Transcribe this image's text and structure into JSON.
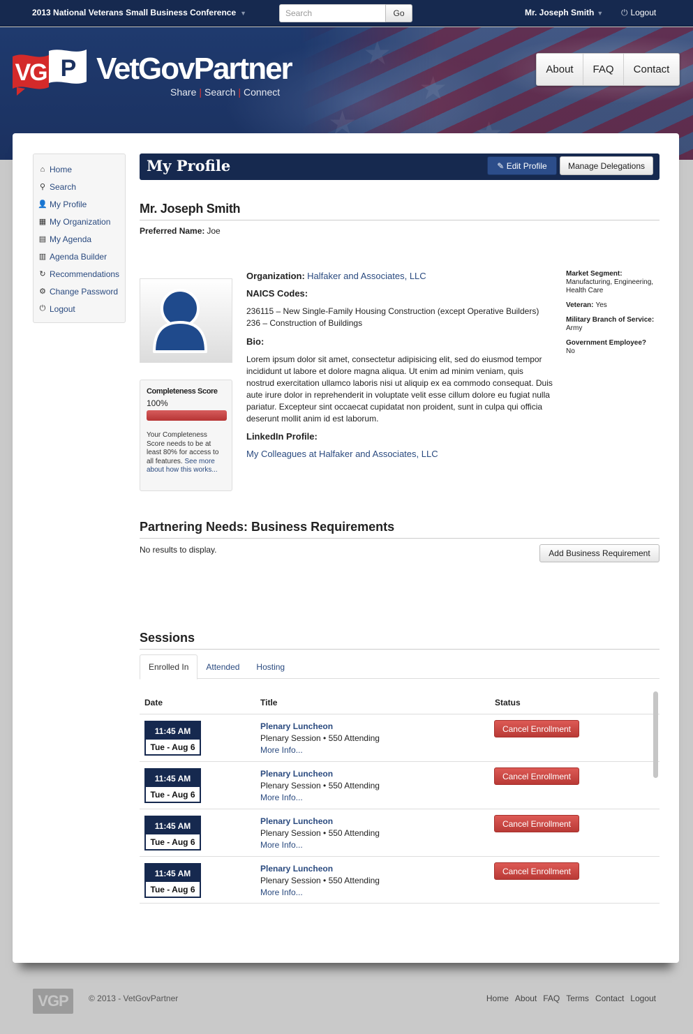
{
  "topbar": {
    "conference": "2013 National Veterans Small Business Conference",
    "search_placeholder": "Search",
    "go_label": "Go",
    "user": "Mr. Joseph Smith",
    "logout": "Logout"
  },
  "brand": {
    "logo_mark": "VGP",
    "name": "VetGovPartner",
    "tagline": [
      "Share",
      "Search",
      "Connect"
    ]
  },
  "nav": [
    "About",
    "FAQ",
    "Contact"
  ],
  "sidebar": [
    {
      "label": "Home",
      "icon": "home-icon",
      "glyph": "⌂"
    },
    {
      "label": "Search",
      "icon": "search-icon",
      "glyph": "⚲"
    },
    {
      "label": "My Profile",
      "icon": "user-icon",
      "glyph": "👤"
    },
    {
      "label": "My Organization",
      "icon": "grid-icon",
      "glyph": "▦"
    },
    {
      "label": "My Agenda",
      "icon": "list-icon",
      "glyph": "▤"
    },
    {
      "label": "Agenda Builder",
      "icon": "calendar-icon",
      "glyph": "▥"
    },
    {
      "label": "Recommendations",
      "icon": "refresh-icon",
      "glyph": "↻"
    },
    {
      "label": "Change Password",
      "icon": "cog-icon",
      "glyph": "⚙"
    },
    {
      "label": "Logout",
      "icon": "power-icon",
      "glyph": "⏻"
    }
  ],
  "header": {
    "title": "My Profile",
    "edit_label": "Edit Profile",
    "delegations_label": "Manage Delegations"
  },
  "profile": {
    "name": "Mr. Joseph Smith",
    "preferred_label": "Preferred Name:",
    "preferred_value": "Joe",
    "org_label": "Organization:",
    "org_value": "Halfaker and Associates, LLC",
    "naics_label": "NAICS Codes:",
    "naics": [
      "236115 – New Single-Family Housing Construction (except Operative Builders)",
      "236 – Construction of Buildings"
    ],
    "bio_label": "Bio:",
    "bio": "Lorem ipsum dolor sit amet, consectetur adipisicing elit, sed do eiusmod tempor incididunt ut labore et dolore magna aliqua. Ut enim ad minim veniam, quis nostrud exercitation ullamco laboris nisi ut aliquip ex ea commodo consequat. Duis aute irure dolor in reprehenderit in voluptate velit esse cillum dolore eu fugiat nulla pariatur. Excepteur sint occaecat cupidatat non proident, sunt in culpa qui officia deserunt mollit anim id est laborum.",
    "linkedin_label": "LinkedIn Profile:",
    "linkedin_link": "My Colleagues at Halfaker and Associates, LLC"
  },
  "completeness": {
    "title": "Completeness Score",
    "value": "100%",
    "fraction": 1.0,
    "note": "Your Completeness Score needs to be at least 80% for access to all features.",
    "link": "See more about how this works..."
  },
  "meta": [
    {
      "label": "Market Segment:",
      "value": "Manufacturing, Engineering, Health Care"
    },
    {
      "label": "Veteran:",
      "value": "Yes",
      "inline": true
    },
    {
      "label": "Military Branch of Service:",
      "value": "Army"
    },
    {
      "label": "Government Employee?",
      "value": "No"
    }
  ],
  "partnering": {
    "heading": "Partnering Needs: Business Requirements",
    "empty": "No results to display.",
    "add_label": "Add Business Requirement"
  },
  "sessions": {
    "heading": "Sessions",
    "tabs": [
      "Enrolled In",
      "Attended",
      "Hosting"
    ],
    "columns": [
      "Date",
      "Title",
      "Status"
    ],
    "rows": [
      {
        "time": "11:45 AM",
        "day": "Tue - Aug 6",
        "title": "Plenary Luncheon",
        "sub": "Plenary Session • 550 Attending",
        "more": "More Info...",
        "action": "Cancel Enrollment"
      },
      {
        "time": "11:45 AM",
        "day": "Tue - Aug 6",
        "title": "Plenary Luncheon",
        "sub": "Plenary Session • 550 Attending",
        "more": "More Info...",
        "action": "Cancel Enrollment"
      },
      {
        "time": "11:45 AM",
        "day": "Tue - Aug 6",
        "title": "Plenary Luncheon",
        "sub": "Plenary Session • 550 Attending",
        "more": "More Info...",
        "action": "Cancel Enrollment"
      },
      {
        "time": "11:45 AM",
        "day": "Tue - Aug 6",
        "title": "Plenary Luncheon",
        "sub": "Plenary Session • 550 Attending",
        "more": "More Info...",
        "action": "Cancel Enrollment"
      }
    ]
  },
  "footer": {
    "logo": "VGP",
    "copyright": "© 2013 - VetGovPartner",
    "links": [
      "Home",
      "About",
      "FAQ",
      "Terms",
      "Contact",
      "Logout"
    ]
  },
  "colors": {
    "navy": "#16294f",
    "link": "#2a4a7f",
    "danger": "#c9413d",
    "brand_red": "#d42a2a"
  }
}
